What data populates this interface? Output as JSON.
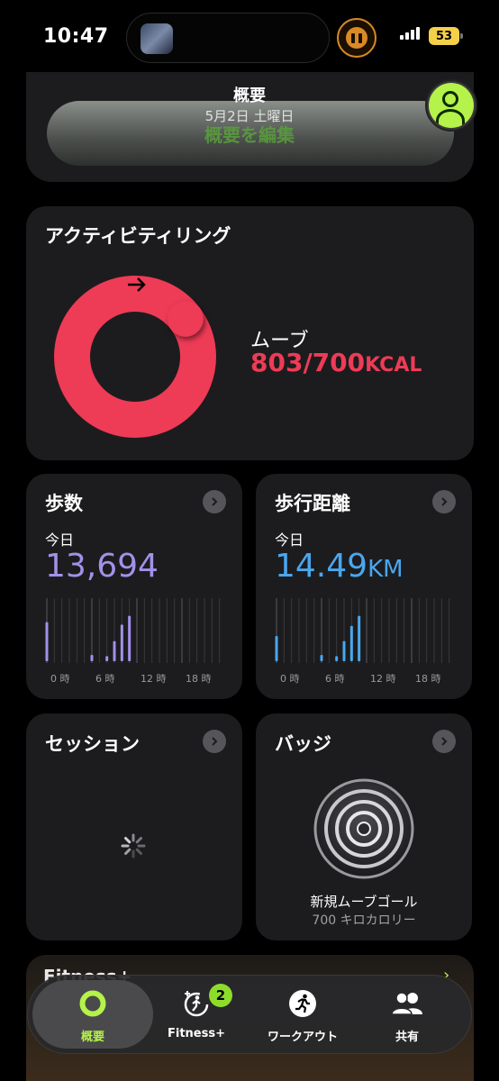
{
  "status_bar": {
    "time": "10:47",
    "battery": "53"
  },
  "header": {
    "title": "概要",
    "date": "5月2日 土曜日",
    "edit_label": "概要を編集"
  },
  "activity": {
    "title": "アクティビティリング",
    "move_label": "ムーブ",
    "move_value": "803/700",
    "move_unit": "KCAL",
    "move_current": 803,
    "move_goal": 700,
    "ring_color": "#ee3b56"
  },
  "steps": {
    "title": "歩数",
    "today_label": "今日",
    "value": "13,694",
    "color": "#a391e8",
    "axis_labels": [
      "0 時",
      "6 時",
      "12 時",
      "18 時"
    ],
    "hourly": [
      0.62,
      0,
      0,
      0,
      0,
      0,
      0.1,
      0,
      0.08,
      0.32,
      0.58,
      0.72,
      0,
      0,
      0,
      0,
      0,
      0,
      0,
      0,
      0,
      0,
      0,
      0
    ]
  },
  "distance": {
    "title": "歩行距離",
    "today_label": "今日",
    "value": "14.49",
    "unit": "KM",
    "color": "#4aa7ee",
    "axis_labels": [
      "0 時",
      "6 時",
      "12 時",
      "18 時"
    ],
    "hourly": [
      0.4,
      0,
      0,
      0,
      0,
      0,
      0.1,
      0,
      0.08,
      0.32,
      0.56,
      0.72,
      0,
      0,
      0,
      0,
      0,
      0,
      0,
      0,
      0,
      0,
      0,
      0
    ]
  },
  "sessions": {
    "title": "セッション"
  },
  "badges": {
    "title": "バッジ",
    "badge_name": "新規ムーブゴール",
    "badge_detail": "700 キロカロリー"
  },
  "fitness_banner": {
    "logo": "Fitness+"
  },
  "tabs": [
    {
      "label": "概要",
      "icon": "activity-ring-icon",
      "active": true
    },
    {
      "label": "Fitness+",
      "icon": "fitness-plus-icon",
      "badge": "2"
    },
    {
      "label": "ワークアウト",
      "icon": "workout-runner-icon"
    },
    {
      "label": "共有",
      "icon": "sharing-people-icon"
    }
  ],
  "accent_color": "#b5f24a"
}
